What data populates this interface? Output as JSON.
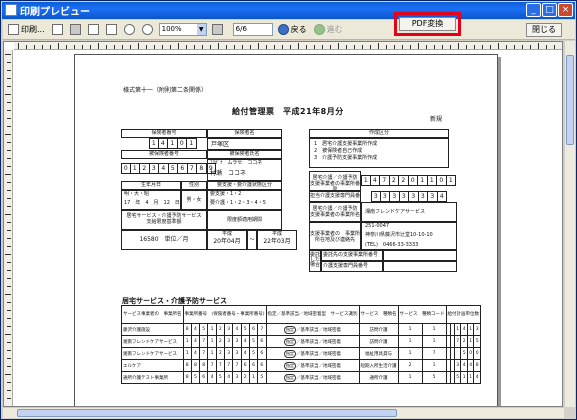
{
  "window": {
    "title": "印刷プレビュー"
  },
  "toolbar": {
    "print_label": "印刷...",
    "zoom_value": "100%",
    "page_value": "6/6",
    "back_label": "戻る",
    "next_label": "進む",
    "pdf_label": "PDF変換",
    "close_label": "閉じる"
  },
  "doc": {
    "form_no": "様式第十一（附則第二条関係）",
    "title": "給付管理票　平成21年8月分",
    "new_label": "新規",
    "insurer_no_label": "保険者番号",
    "insurer_no_digits": [
      "1",
      "4",
      "1",
      "0",
      "1"
    ],
    "insurer_name_label": "保険者名",
    "insurer_name": "戸塚区",
    "insured_no_label": "被保険者番号",
    "insured_no_digits": [
      "0",
      "1",
      "2",
      "3",
      "4",
      "5",
      "6",
      "7",
      "8",
      "9"
    ],
    "insured_name_label": "被保険者氏名",
    "insured_kana": "ﾌﾘｶﾞﾅ　ムラセ　ココネ",
    "insured_name": "村瀬　ココネ",
    "birth_label": "生年月日",
    "sex_label": "性別",
    "care_level_label": "要支援・要介護状態区分",
    "era": "明・大・昭",
    "birth_value": "17　年　4　月　12　日",
    "sex_value": "男・女",
    "support_levels": "要支援・1・2",
    "care_levels": "要介護・1・2・3・4・5",
    "limit_label": "居宅サービス・介護予防サービス　支給限度基準額",
    "limit_value": "16580　単位／月",
    "period_label": "限度額適用期間",
    "period_from_era": "平成",
    "period_from": "20年04月",
    "period_tilde": "〜",
    "period_to_era": "平成",
    "period_to": "22年03月",
    "creation_label": "作成区分",
    "creation_options": [
      "1　居宅介護支援事業所作成",
      "2　被保険者自己作成",
      "3　介護予防支援事業所作成"
    ],
    "office_no_label": "居宅介護／介護予防　支援事業者の事業所番号",
    "office_no_digits": [
      "1",
      "4",
      "7",
      "2",
      "2",
      "0",
      "1",
      "1",
      "0",
      "1"
    ],
    "worker_no_label": "担当介護支援専門員番号",
    "worker_no_digits": [
      "3",
      "3",
      "3",
      "3",
      "3",
      "3",
      "3",
      "4"
    ],
    "office_name_label": "居宅介護／介護予防　支援事業者の事業所名",
    "office_name": "湘南フレンドケアサービス",
    "office_addr_label": "支援事業者の　事業所所在地及び連絡先",
    "office_zip": "251-0047",
    "office_addr": "神奈川県藤沢市辻堂10-10-10",
    "office_tel": "(TEL)　0466-33-3333",
    "entrust_label": "委託した場合",
    "entrust_row1": "委託先の支援事業所番号",
    "entrust_row2": "介護支援専門員番号",
    "service_section_title": "居宅サービス・介護予防サービス",
    "service_headers": [
      "サービス事業者の　事業所名",
      "事業所番号　(保険者番号・事業所番号)",
      "指定／基準該当／地域密着型　サービス識別",
      "サービス　種類名",
      "サービス　種類コード",
      "給付計画単位数"
    ],
    "service_rows": [
      {
        "name": "藤沢介護施設",
        "digits": [
          "8",
          "4",
          "5",
          "1",
          "2",
          "3",
          "4",
          "5",
          "6",
          "7"
        ],
        "kind": "指定",
        "type": "訪問介護",
        "code": [
          "1",
          "1"
        ],
        "units": [
          "",
          "",
          "1",
          "4",
          "1",
          "3"
        ]
      },
      {
        "name": "湘南フレンドケアサービス",
        "digits": [
          "1",
          "4",
          "7",
          "1",
          "2",
          "3",
          "3",
          "4",
          "5",
          "6"
        ],
        "kind": "指定",
        "type": "訪問介護",
        "code": [
          "1",
          "1"
        ],
        "units": [
          "",
          "",
          "7",
          "2",
          "1",
          "5"
        ]
      },
      {
        "name": "湘南フレンドケアサービス",
        "digits": [
          "1",
          "4",
          "7",
          "1",
          "2",
          "3",
          "3",
          "4",
          "5",
          "6"
        ],
        "kind": "指定",
        "type": "福祉用具貸与",
        "code": [
          "1",
          "7"
        ],
        "units": [
          "",
          "",
          "",
          "5",
          "0",
          "0"
        ]
      },
      {
        "name": "エルケア",
        "digits": [
          "8",
          "8",
          "8",
          "7",
          "7",
          "7",
          "7",
          "6",
          "6",
          "6"
        ],
        "kind": "指定",
        "type": "短期入所生活介護",
        "code": [
          "2",
          "1"
        ],
        "units": [
          "",
          "",
          "3",
          "4",
          "4",
          "8"
        ]
      },
      {
        "name": "通所介護テスト事業所",
        "digits": [
          "8",
          "5",
          "6",
          "4",
          "5",
          "4",
          "3",
          "2",
          "1",
          "5"
        ],
        "kind": "指定",
        "type": "通所介護",
        "code": [
          "1",
          "5"
        ],
        "units": [
          "",
          "",
          "5",
          "1",
          "1",
          "4"
        ]
      }
    ],
    "service_kind_tail": "／基準該当／地域密着"
  }
}
